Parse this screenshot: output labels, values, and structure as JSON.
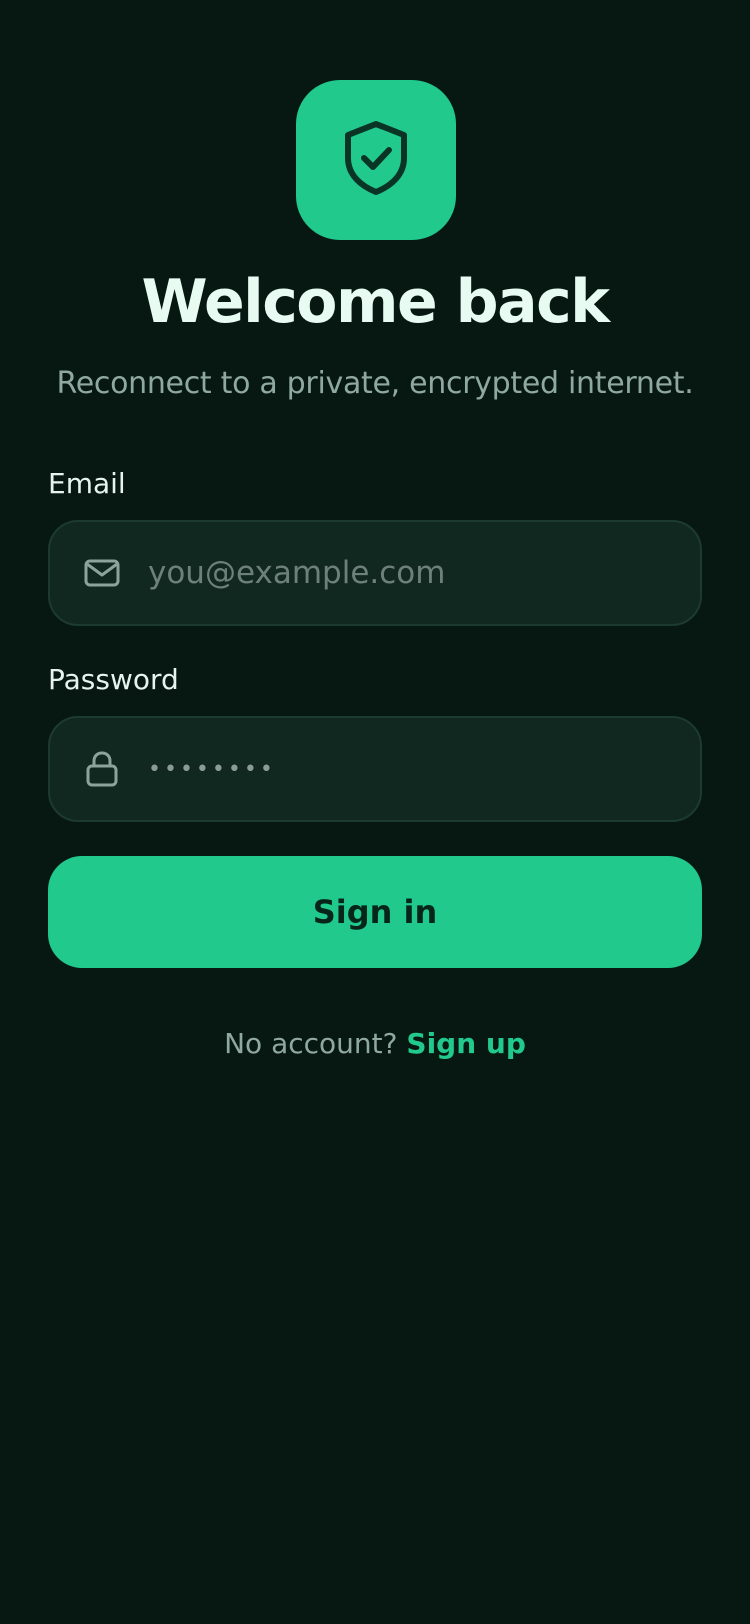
{
  "colors": {
    "background": "#071813",
    "accent": "#22c98c",
    "field_bg": "#112821"
  },
  "logo": {
    "icon": "shield-check-icon"
  },
  "header": {
    "title": "Welcome back",
    "subtitle": "Reconnect to a private, encrypted internet."
  },
  "form": {
    "email": {
      "label": "Email",
      "icon": "mail-icon",
      "placeholder": "you@example.com",
      "value": ""
    },
    "password": {
      "label": "Password",
      "icon": "lock-icon",
      "placeholder": "••••••••",
      "value": ""
    },
    "submit_label": "Sign in"
  },
  "footer": {
    "prompt": "No account?",
    "link_label": "Sign up"
  }
}
